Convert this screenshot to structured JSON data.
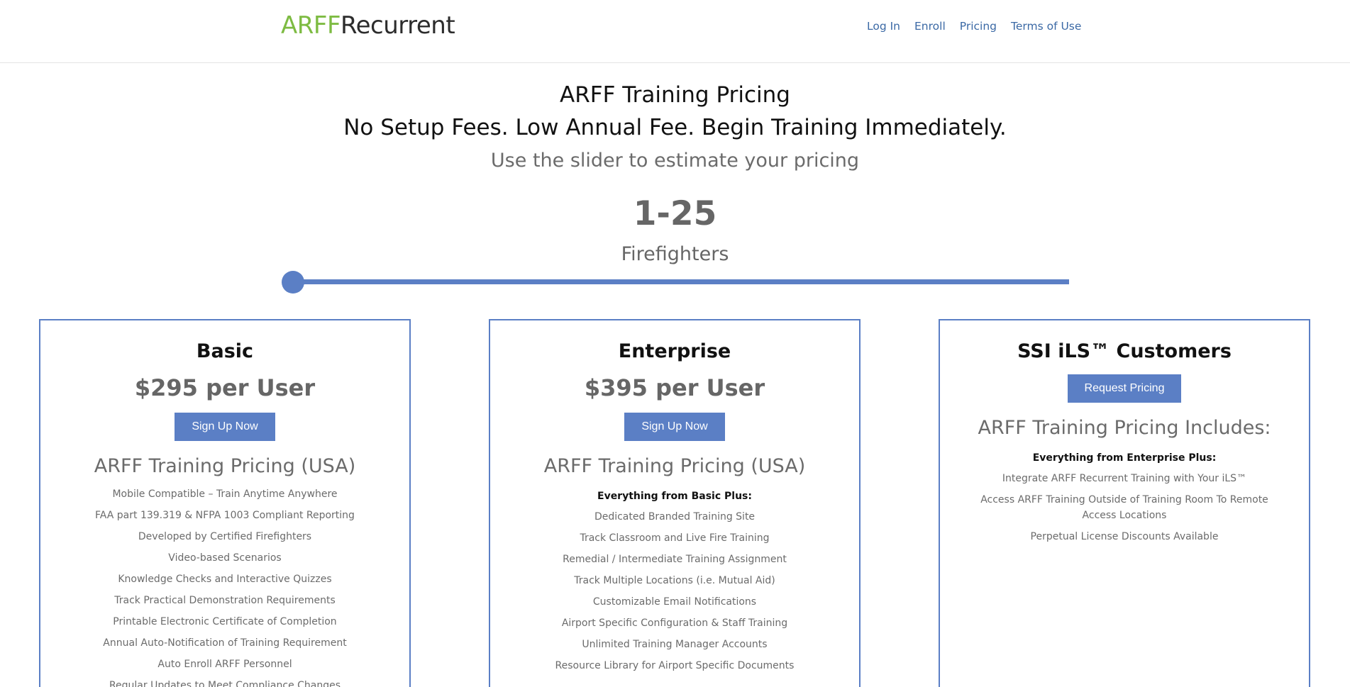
{
  "header": {
    "logo_part1": "ARFF",
    "logo_part2": "Recurrent",
    "nav": [
      "Log In",
      "Enroll",
      "Pricing",
      "Terms of Use"
    ]
  },
  "hero": {
    "title": "ARFF Training Pricing",
    "subtitle": "No Setup Fees. Low Annual Fee. Begin Training Immediately.",
    "hint": "Use the slider to estimate your pricing",
    "range": "1-25",
    "unit": "Firefighters"
  },
  "slider": {
    "value_fraction": 0.0
  },
  "cards": [
    {
      "title": "Basic",
      "price": "$295 per User",
      "button": "Sign Up Now",
      "section": "ARFF Training Pricing (USA)",
      "lead": "",
      "items": [
        "Mobile Compatible – Train Anytime Anywhere",
        "FAA part 139.319 & NFPA 1003 Compliant Reporting",
        "Developed by Certified Firefighters",
        "Video-based Scenarios",
        "Knowledge Checks and Interactive Quizzes",
        "Track Practical Demonstration Requirements",
        "Printable Electronic Certificate of Completion",
        "Annual Auto-Notification of Training Requirement",
        "Auto Enroll ARFF Personnel",
        "Regular Updates to Meet Compliance Changes"
      ]
    },
    {
      "title": "Enterprise",
      "price": "$395 per User",
      "button": "Sign Up Now",
      "section": "ARFF Training Pricing (USA)",
      "lead": "Everything from Basic Plus:",
      "items": [
        "Dedicated Branded Training Site",
        "Track Classroom and Live Fire Training",
        "Remedial / Intermediate Training Assignment",
        "Track Multiple Locations (i.e. Mutual Aid)",
        "Customizable Email Notifications",
        "Airport Specific Configuration & Staff Training",
        "Unlimited Training Manager Accounts",
        "Resource Library for Airport Specific Documents"
      ]
    },
    {
      "title": "SSI iLS™ Customers",
      "price": "",
      "button": "Request Pricing",
      "section": "ARFF Training Pricing Includes:",
      "lead": "Everything from Enterprise Plus:",
      "items": [
        "Integrate ARFF Recurrent Training with Your iLS™",
        "Access ARFF Training Outside of Training Room To Remote Access Locations",
        "Perpetual License Discounts Available"
      ]
    }
  ],
  "colors": {
    "accent": "#5b7fc5",
    "logo_green": "#7dbb42",
    "nav_link": "#3b69a5"
  }
}
